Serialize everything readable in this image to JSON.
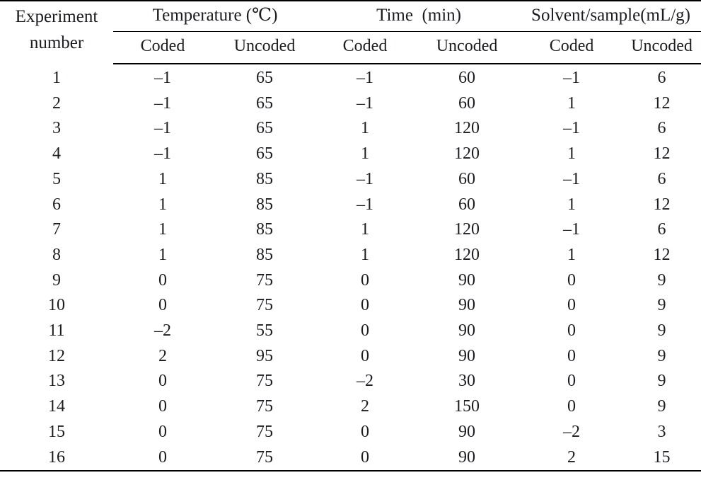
{
  "table": {
    "caption_visible": false,
    "header": {
      "row_label": {
        "line1": "Experiment",
        "line2": "number"
      },
      "groups": [
        {
          "label": "Temperature (℃)",
          "span": 2
        },
        {
          "label": "Time (min)",
          "span": 2
        },
        {
          "label": "Solvent/sample(mL/g)",
          "span": 2
        }
      ],
      "subheaders": [
        "Coded",
        "Uncoded",
        "Coded",
        "Uncoded",
        "Coded",
        "Uncoded"
      ]
    },
    "columns": [
      "Experiment number",
      "Temperature Coded",
      "Temperature Uncoded",
      "Time Coded",
      "Time Uncoded",
      "Solvent/sample Coded",
      "Solvent/sample Uncoded"
    ],
    "rows": [
      {
        "no": "1",
        "temp_coded": "–1",
        "temp_uncoded": "65",
        "time_coded": "–1",
        "time_uncoded": "60",
        "sol_coded": "–1",
        "sol_uncoded": "6"
      },
      {
        "no": "2",
        "temp_coded": "–1",
        "temp_uncoded": "65",
        "time_coded": "–1",
        "time_uncoded": "60",
        "sol_coded": "1",
        "sol_uncoded": "12"
      },
      {
        "no": "3",
        "temp_coded": "–1",
        "temp_uncoded": "65",
        "time_coded": "1",
        "time_uncoded": "120",
        "sol_coded": "–1",
        "sol_uncoded": "6"
      },
      {
        "no": "4",
        "temp_coded": "–1",
        "temp_uncoded": "65",
        "time_coded": "1",
        "time_uncoded": "120",
        "sol_coded": "1",
        "sol_uncoded": "12"
      },
      {
        "no": "5",
        "temp_coded": "1",
        "temp_uncoded": "85",
        "time_coded": "–1",
        "time_uncoded": "60",
        "sol_coded": "–1",
        "sol_uncoded": "6"
      },
      {
        "no": "6",
        "temp_coded": "1",
        "temp_uncoded": "85",
        "time_coded": "–1",
        "time_uncoded": "60",
        "sol_coded": "1",
        "sol_uncoded": "12"
      },
      {
        "no": "7",
        "temp_coded": "1",
        "temp_uncoded": "85",
        "time_coded": "1",
        "time_uncoded": "120",
        "sol_coded": "–1",
        "sol_uncoded": "6"
      },
      {
        "no": "8",
        "temp_coded": "1",
        "temp_uncoded": "85",
        "time_coded": "1",
        "time_uncoded": "120",
        "sol_coded": "1",
        "sol_uncoded": "12"
      },
      {
        "no": "9",
        "temp_coded": "0",
        "temp_uncoded": "75",
        "time_coded": "0",
        "time_uncoded": "90",
        "sol_coded": "0",
        "sol_uncoded": "9"
      },
      {
        "no": "10",
        "temp_coded": "0",
        "temp_uncoded": "75",
        "time_coded": "0",
        "time_uncoded": "90",
        "sol_coded": "0",
        "sol_uncoded": "9"
      },
      {
        "no": "11",
        "temp_coded": "–2",
        "temp_uncoded": "55",
        "time_coded": "0",
        "time_uncoded": "90",
        "sol_coded": "0",
        "sol_uncoded": "9"
      },
      {
        "no": "12",
        "temp_coded": "2",
        "temp_uncoded": "95",
        "time_coded": "0",
        "time_uncoded": "90",
        "sol_coded": "0",
        "sol_uncoded": "9"
      },
      {
        "no": "13",
        "temp_coded": "0",
        "temp_uncoded": "75",
        "time_coded": "–2",
        "time_uncoded": "30",
        "sol_coded": "0",
        "sol_uncoded": "9"
      },
      {
        "no": "14",
        "temp_coded": "0",
        "temp_uncoded": "75",
        "time_coded": "2",
        "time_uncoded": "150",
        "sol_coded": "0",
        "sol_uncoded": "9"
      },
      {
        "no": "15",
        "temp_coded": "0",
        "temp_uncoded": "75",
        "time_coded": "0",
        "time_uncoded": "90",
        "sol_coded": "–2",
        "sol_uncoded": "3"
      },
      {
        "no": "16",
        "temp_coded": "0",
        "temp_uncoded": "75",
        "time_coded": "0",
        "time_uncoded": "90",
        "sol_coded": "2",
        "sol_uncoded": "15"
      }
    ]
  },
  "style": {
    "text_color": "#1b1b22",
    "rule_color": "#000000",
    "background": "#ffffff"
  }
}
